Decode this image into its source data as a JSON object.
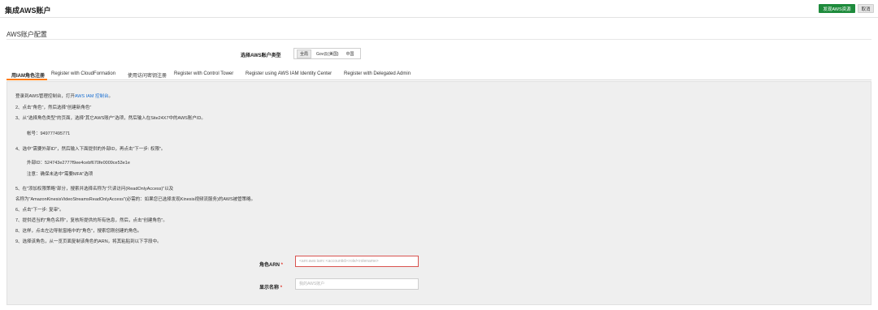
{
  "header": {
    "title": "集成AWS账户",
    "discover_button": "发现AWS资源",
    "cancel_button": "取消"
  },
  "section": {
    "title": "AWS账户配置"
  },
  "account_type": {
    "label": "选择AWS账户类型",
    "options": [
      "全局",
      "Gov云(美国)",
      "中国"
    ],
    "selected": "全局"
  },
  "tabs": [
    {
      "label": "用IAM角色注册",
      "active": true
    },
    {
      "label": "Register with CloudFormation"
    },
    {
      "label": "使用访问密钥注册"
    },
    {
      "label": "Register with Control Tower"
    },
    {
      "label": "Register using AWS IAM Identity Center"
    },
    {
      "label": "Register with Delegated Admin"
    }
  ],
  "instructions": {
    "step1_prefix": "登录到AWS管理控制台，打开",
    "step1_link": "AWS IAM 控制台",
    "step1_suffix": "。",
    "step2": "2、点击\"角色\"，然后选择\"创建新角色\"",
    "step3": "3、从\"选择角色类型\"的页面，选择\"其它AWS账户\"选项，然后输入在Site24X7中的AWS账户ID。",
    "account_id": "帐号：949777495771",
    "step4": "4、选中\"需要外部ID\"，然后输入下面提供的外部ID，再点击\"下一步: 权限\"。",
    "external_id": "外部ID：524743e2777f9ee4cebf670fe0009ce53e1e",
    "external_note": "注意：确保未选中\"需要MFA\"选项",
    "step5": "5、在\"添加权限策略\"部分，搜索并选择名称为\"只读访问(ReadOnlyAccess)\"以及",
    "step5b": "名称为\"AmazonKinesisVideoStreamsReadOnlyAccess\"(必需的：如果您已选择发现Kinesis视频流服务)的AWS被管策略。",
    "step6": "6、点击\"下一步: 复审\"。",
    "step7": "7、提供适当的\"角色名称\"，复核所提供的所有信息，然后，点击\"创建角色\"。",
    "step8": "8、这样，点击左边导航窗格中的\"角色\"，搜索您刚创建的角色。",
    "step9": "9、选择该角色，从一览页面复制该角色的ARN，将其粘贴到以下字段中。"
  },
  "form": {
    "role_arn_label": "角色ARN",
    "role_arn_placeholder": "<arn:aws:iam::<accountid>:role/<rolename>",
    "display_name_label": "显示名称",
    "display_name_placeholder": "我的AWS账户",
    "required_mark": "*"
  }
}
